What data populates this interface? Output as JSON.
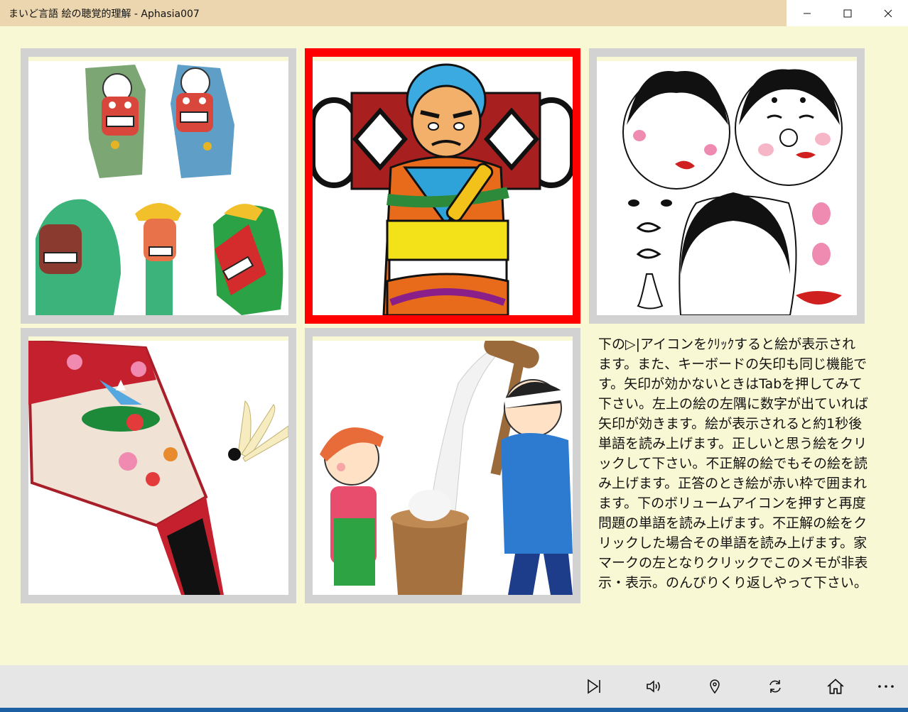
{
  "window": {
    "title": "まいど言語 絵の聴覚的理解 - Aphasia007"
  },
  "cards": [
    {
      "name": "shishimai-masks",
      "selected": false
    },
    {
      "name": "daruma-warrior-kite",
      "selected": true
    },
    {
      "name": "okame-fukuwarai",
      "selected": false
    },
    {
      "name": "hagoita-paddle",
      "selected": false
    },
    {
      "name": "mochitsuki",
      "selected": false
    }
  ],
  "memo": {
    "text": "下の▷|アイコンをｸﾘｯｸすると絵が表示されます。また、キーボードの矢印も同じ機能です。矢印が効かないときはTabを押してみて下さい。左上の絵の左隅に数字が出ていれば矢印が効きます。絵が表示されると約1秒後単語を読み上げます。正しいと思う絵をクリックして下さい。不正解の絵でもその絵を読み上げます。正答のとき絵が赤い枠で囲まれます。下のボリュームアイコンを押すと再度問題の単語を読み上げます。不正解の絵をクリックした場合その単語を読み上げます。家マークの左となりクリックでこのメモが非表示・表示。のんびりくり返しやって下さい。"
  },
  "colors": {
    "background": "#f9f8d4",
    "titlebar": "#ecd6b0",
    "selected_border": "#ff0000",
    "card_border": "#d2d2d2",
    "taskbar": "#e6e6e6"
  },
  "toolbar": {
    "icons": [
      "next-icon",
      "volume-icon",
      "location-pin-icon",
      "refresh-icon",
      "home-icon",
      "more-icon"
    ]
  }
}
